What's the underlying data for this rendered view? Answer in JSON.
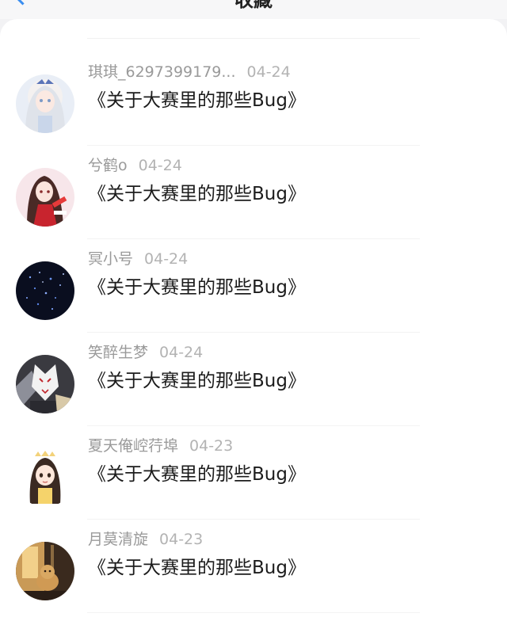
{
  "header": {
    "title": "收藏"
  },
  "items": [
    {
      "name": "琪琪_6297399179...",
      "date": "04-24",
      "title": "《关于大赛里的那些Bug》",
      "avatar_icon": "anime-girl-white-hair-avatar-icon"
    },
    {
      "name": "兮鹤o",
      "date": "04-24",
      "title": "《关于大赛里的那些Bug》",
      "avatar_icon": "anime-girl-red-kimono-avatar-icon"
    },
    {
      "name": "冥小号",
      "date": "04-24",
      "title": "《关于大赛里的那些Bug》",
      "avatar_icon": "night-sky-stars-avatar-icon"
    },
    {
      "name": "笑醉生梦",
      "date": "04-24",
      "title": "《关于大赛里的那些Bug》",
      "avatar_icon": "fox-mask-avatar-icon"
    },
    {
      "name": "夏天俺崆荇埠",
      "date": "04-23",
      "title": "《关于大赛里的那些Bug》",
      "avatar_icon": "chibi-girl-crown-avatar-icon"
    },
    {
      "name": "月莫清旋",
      "date": "04-23",
      "title": "《关于大赛里的那些Bug》",
      "avatar_icon": "dog-sunset-avatar-icon"
    }
  ],
  "colors": {
    "accent": "#3a8ef0"
  }
}
